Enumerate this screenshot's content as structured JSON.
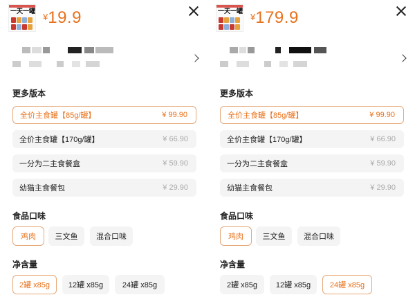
{
  "panels": [
    {
      "product_thumb_text": "一天一罐",
      "price_currency": "¥",
      "price_value": "19.9",
      "more_versions_title": "更多版本",
      "versions": [
        {
          "name": "全价主食罐【85g/罐】",
          "price": "¥ 99.90",
          "selected": true
        },
        {
          "name": "全价主食罐【170g/罐】",
          "price": "¥ 66.90",
          "selected": false
        },
        {
          "name": "一分为二主食餐盒",
          "price": "¥ 59.90",
          "selected": false
        },
        {
          "name": "幼猫主食餐包",
          "price": "¥ 29.90",
          "selected": false
        }
      ],
      "flavor_title": "食品口味",
      "flavors": [
        {
          "label": "鸡肉",
          "selected": true
        },
        {
          "label": "三文鱼",
          "selected": false
        },
        {
          "label": "混合口味",
          "selected": false
        }
      ],
      "net_title": "净含量",
      "nets": [
        {
          "label": "2罐 x85g",
          "selected": true
        },
        {
          "label": "12罐 x85g",
          "selected": false
        },
        {
          "label": "24罐 x85g",
          "selected": false
        }
      ]
    },
    {
      "product_thumb_text": "一天一罐",
      "price_currency": "¥",
      "price_value": "179.9",
      "more_versions_title": "更多版本",
      "versions": [
        {
          "name": "全价主食罐【85g/罐】",
          "price": "¥ 99.90",
          "selected": true
        },
        {
          "name": "全价主食罐【170g/罐】",
          "price": "¥ 66.90",
          "selected": false
        },
        {
          "name": "一分为二主食餐盒",
          "price": "¥ 59.90",
          "selected": false
        },
        {
          "name": "幼猫主食餐包",
          "price": "¥ 29.90",
          "selected": false
        }
      ],
      "flavor_title": "食品口味",
      "flavors": [
        {
          "label": "鸡肉",
          "selected": true
        },
        {
          "label": "三文鱼",
          "selected": false
        },
        {
          "label": "混合口味",
          "selected": false
        }
      ],
      "net_title": "净含量",
      "nets": [
        {
          "label": "2罐 x85g",
          "selected": false
        },
        {
          "label": "12罐 x85g",
          "selected": false
        },
        {
          "label": "24罐 x85g",
          "selected": true
        }
      ]
    }
  ],
  "colors": {
    "accent": "#e8711b",
    "selected_border": "#e6a878",
    "option_bg": "#f4f4f4",
    "muted_price": "#aaaaaa"
  },
  "icons": {
    "close": "close-icon",
    "chevron": "chevron-right-icon"
  }
}
